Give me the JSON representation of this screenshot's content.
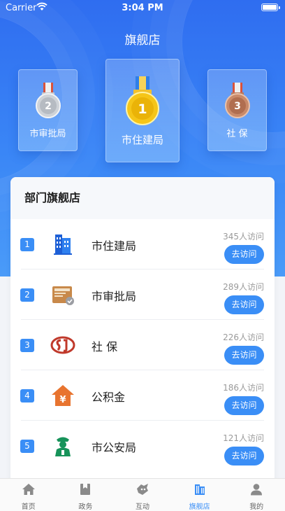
{
  "status_bar": {
    "carrier": "Carrier",
    "time": "3:04 PM"
  },
  "page_title": "旗舰店",
  "podium": [
    {
      "rank": "2",
      "name": "市审批局",
      "medal": "silver-medal-icon"
    },
    {
      "rank": "1",
      "name": "市住建局",
      "medal": "gold-medal-icon"
    },
    {
      "rank": "3",
      "name": "社 保",
      "medal": "bronze-medal-icon"
    }
  ],
  "section_title": "部门旗舰店",
  "departments": [
    {
      "rank": "1",
      "name": "市住建局",
      "visits": "345人访问",
      "button": "去访问",
      "icon": "building-icon"
    },
    {
      "rank": "2",
      "name": "市审批局",
      "visits": "289人访问",
      "button": "去访问",
      "icon": "approval-folder-icon"
    },
    {
      "rank": "3",
      "name": "社 保",
      "visits": "226人访问",
      "button": "去访问",
      "icon": "social-security-logo-icon"
    },
    {
      "rank": "4",
      "name": "公积金",
      "visits": "186人访问",
      "button": "去访问",
      "icon": "housing-fund-icon"
    },
    {
      "rank": "5",
      "name": "市公安局",
      "visits": "121人访问",
      "button": "去访问",
      "icon": "police-icon"
    }
  ],
  "tabs": [
    {
      "label": "首页",
      "icon": "home-icon",
      "active": false
    },
    {
      "label": "政务",
      "icon": "government-icon",
      "active": false
    },
    {
      "label": "互动",
      "icon": "interaction-icon",
      "active": false
    },
    {
      "label": "旗舰店",
      "icon": "flagship-store-icon",
      "active": true
    },
    {
      "label": "我的",
      "icon": "profile-icon",
      "active": false
    }
  ],
  "colors": {
    "accent": "#3a8ef6",
    "hero_top": "#2f6df0",
    "gold": "#f5c518",
    "silver": "#cfd3d8",
    "bronze": "#c98a6a"
  }
}
